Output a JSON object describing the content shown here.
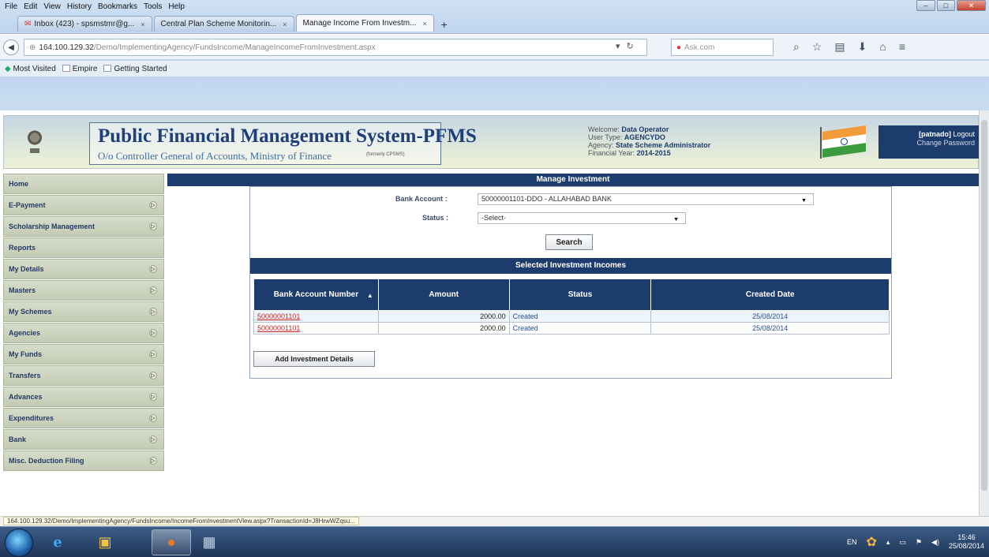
{
  "browser": {
    "menu": [
      "File",
      "Edit",
      "View",
      "History",
      "Bookmarks",
      "Tools",
      "Help"
    ],
    "tabs": [
      {
        "label": "Inbox (423) - spsmstmr@g...",
        "active": false
      },
      {
        "label": "Central Plan Scheme Monitorin...",
        "active": false
      },
      {
        "label": "Manage Income From Investm...",
        "active": true
      }
    ],
    "url_host": "164.100.129.32",
    "url_path": "/Demo/ImplementingAgency/FundsIncome/ManageIncomeFromInvestment.aspx",
    "search_placeholder": "Ask.com",
    "bookmarks": [
      "Most Visited",
      "Empire",
      "Getting Started"
    ],
    "status_url": "164.100.129.32/Demo/ImplementingAgency/FundsIncome/IncomeFromInvestmentView.aspx?TransactionId=J8HrwWZqsu..."
  },
  "header": {
    "title": "Public Financial Management System-PFMS",
    "subtitle": "O/o Controller General of Accounts, Ministry of Finance",
    "tag": "(formerly CPSMS)",
    "welcome_label": "Welcome:",
    "welcome_value": "Data Operator",
    "user_type_label": "User Type:",
    "user_type_value": "AGENCYDO",
    "agency_label": "Agency:",
    "agency_value": "State Scheme Administrator",
    "fy_label": "Financial Year:",
    "fy_value": "2014-2015",
    "username": "[patnado]",
    "logout": "Logout",
    "change_password": "Change Password"
  },
  "sidebar": {
    "items": [
      {
        "label": "Home",
        "has_sub": false
      },
      {
        "label": "E-Payment",
        "has_sub": true
      },
      {
        "label": "Scholarship Management",
        "has_sub": true
      },
      {
        "label": "Reports",
        "has_sub": false
      },
      {
        "label": "My Details",
        "has_sub": true
      },
      {
        "label": "Masters",
        "has_sub": true
      },
      {
        "label": "My Schemes",
        "has_sub": true
      },
      {
        "label": "Agencies",
        "has_sub": true
      },
      {
        "label": "My Funds",
        "has_sub": true
      },
      {
        "label": "Transfers",
        "has_sub": true
      },
      {
        "label": "Advances",
        "has_sub": true
      },
      {
        "label": "Expenditures",
        "has_sub": true
      },
      {
        "label": "Bank",
        "has_sub": true
      },
      {
        "label": "Misc. Deduction Filing",
        "has_sub": true
      }
    ]
  },
  "main": {
    "title": "Manage Investment",
    "bank_account_label": "Bank Account :",
    "bank_account_value": "50000001101-DDO - ALLAHABAD BANK",
    "status_label": "Status :",
    "status_value": "-Select-",
    "search_button": "Search",
    "selected_title": "Selected Investment Incomes",
    "columns": [
      "Bank Account Number",
      "Amount",
      "Status",
      "Created Date"
    ],
    "rows": [
      {
        "account": "50000001101",
        "amount": "2000.00",
        "status": "Created",
        "date": "25/08/2014"
      },
      {
        "account": "50000001101",
        "amount": "2000.00",
        "status": "Created",
        "date": "25/08/2014"
      }
    ],
    "add_button": "Add Investment Details"
  },
  "taskbar": {
    "lang": "EN",
    "time": "15:46",
    "date": "25/08/2014"
  },
  "colors": {
    "navy": "#1d3c6e",
    "link_red": "#c0251d",
    "sidebar_bg": "#c4cbb4"
  }
}
